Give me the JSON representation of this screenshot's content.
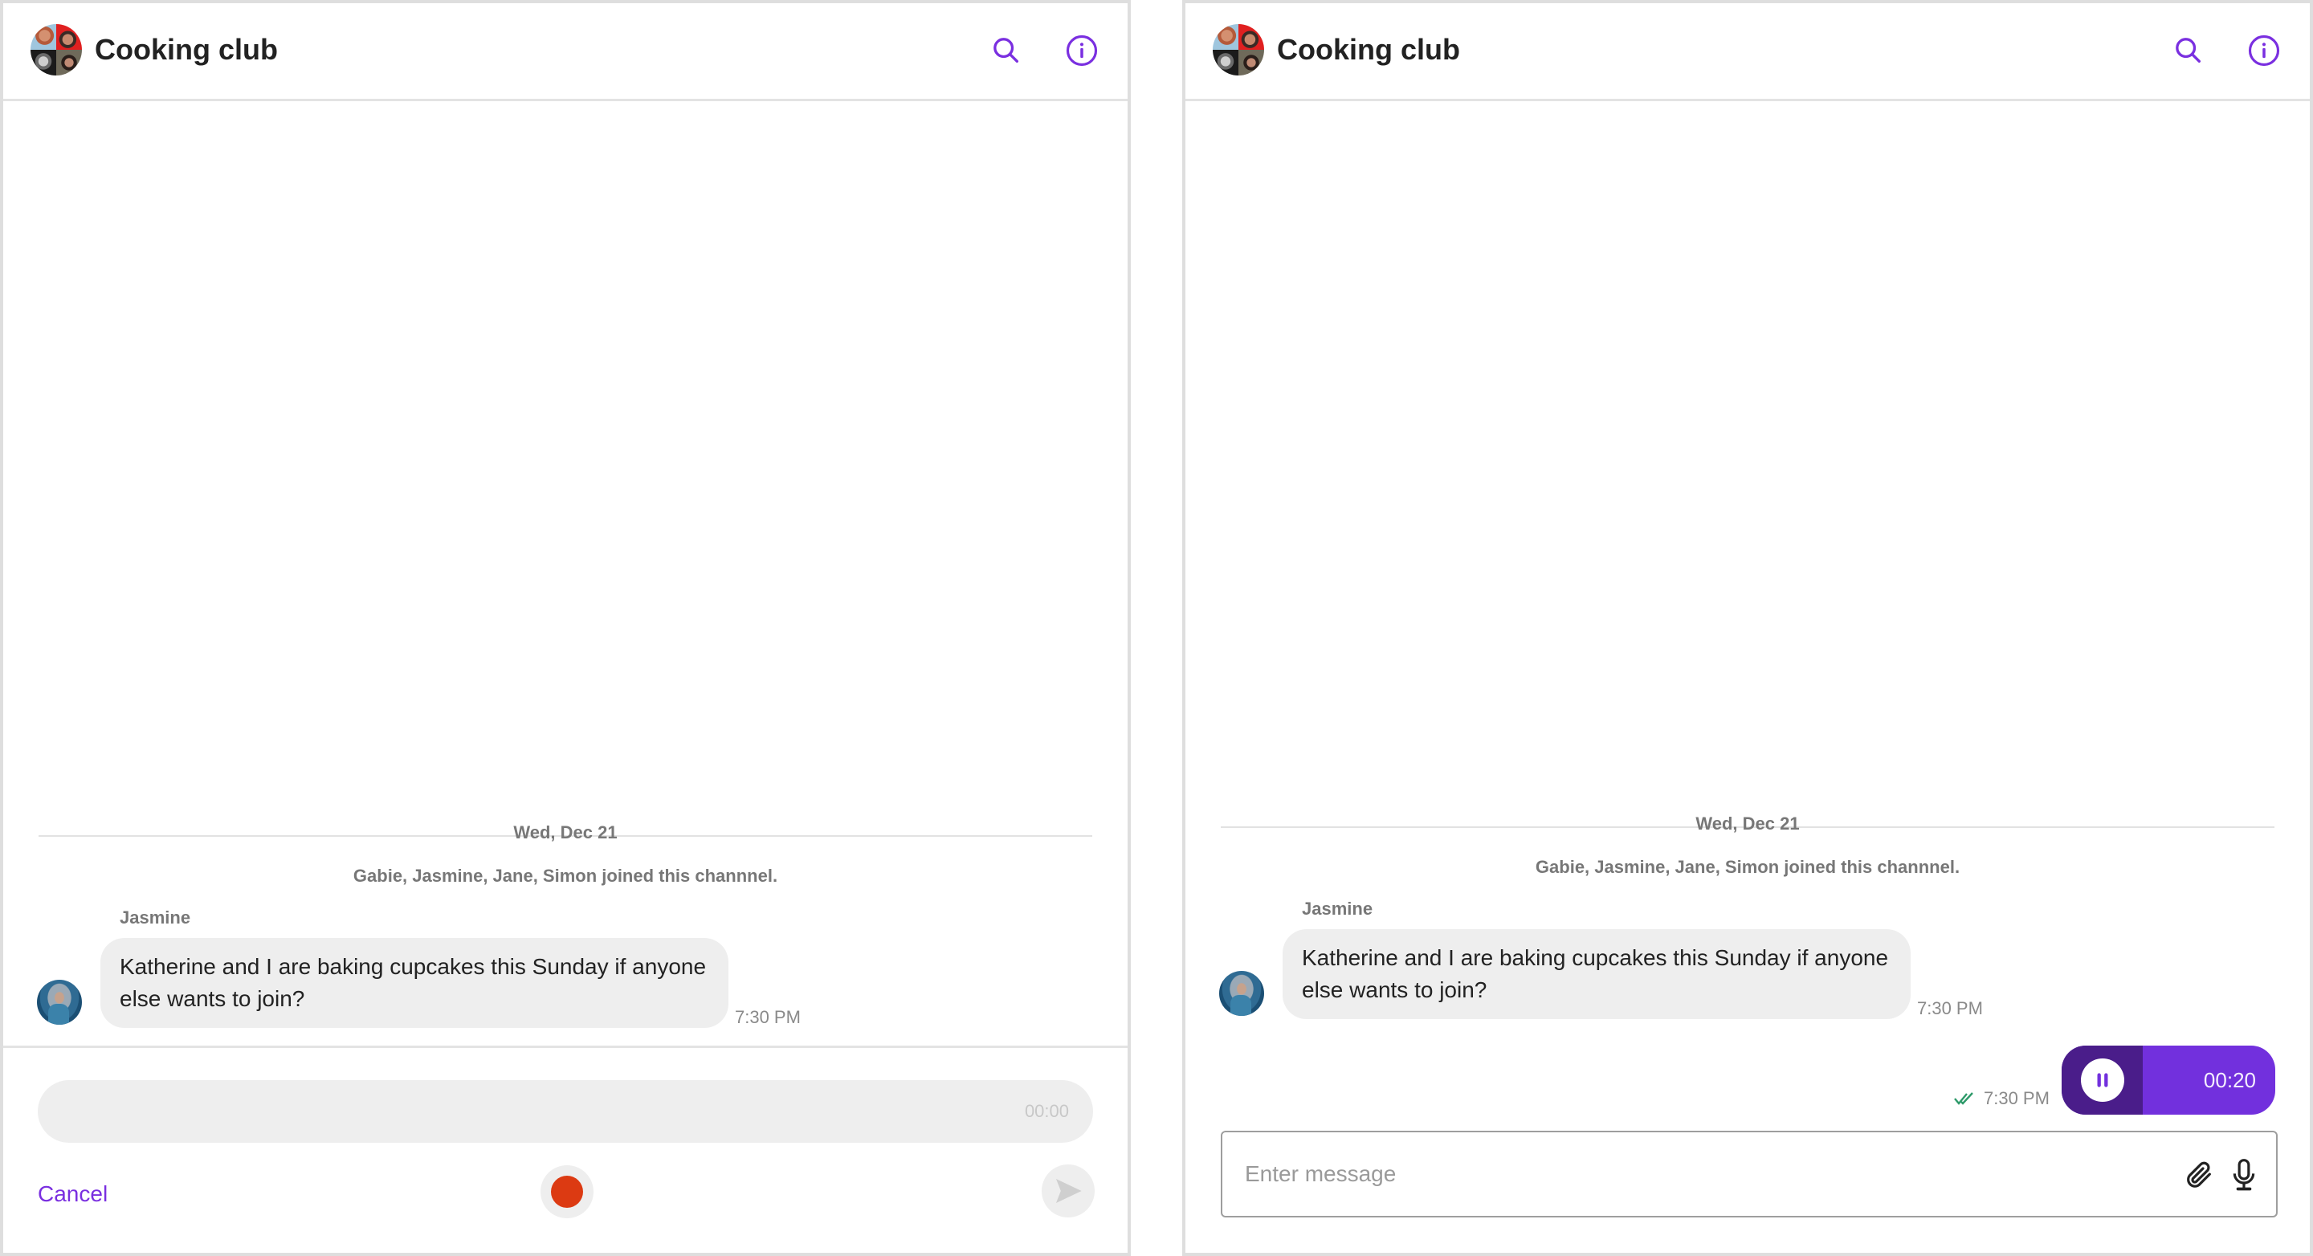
{
  "colors": {
    "accent": "#7a2fe0",
    "record_red": "#dc3a12",
    "voice_bubble": "#7230dd",
    "voice_progress": "#4a1d8a",
    "read_check": "#2e9a6a",
    "bubble_bg": "#eeeeee"
  },
  "panels": [
    {
      "header": {
        "title": "Cooking club",
        "avatar_icon": "group-avatar",
        "search_icon": "search-icon",
        "info_icon": "info-icon"
      },
      "messages": {
        "date_divider": "Wed, Dec 21",
        "system_message": "Gabie, Jasmine, Jane, Simon joined this channnel.",
        "incoming": {
          "sender": "Jasmine",
          "text": "Katherine and I are baking cupcakes this Sunday if anyone else wants to join?",
          "time": "7:30 PM"
        }
      },
      "recorder": {
        "elapsed": "00:00",
        "cancel_label": "Cancel",
        "record_icon": "record-icon",
        "send_icon": "send-icon"
      }
    },
    {
      "header": {
        "title": "Cooking club",
        "avatar_icon": "group-avatar",
        "search_icon": "search-icon",
        "info_icon": "info-icon"
      },
      "messages": {
        "date_divider": "Wed, Dec 21",
        "system_message": "Gabie, Jasmine, Jane, Simon joined this channnel.",
        "incoming": {
          "sender": "Jasmine",
          "text": "Katherine and I are baking cupcakes this Sunday if anyone else wants to join?",
          "time": "7:30 PM"
        },
        "outgoing_voice": {
          "time": "7:30 PM",
          "status": "read",
          "status_icon": "double-check-icon",
          "play_state_icon": "pause-icon",
          "duration": "00:20",
          "progress_fraction": 0.38
        }
      },
      "composer": {
        "placeholder": "Enter message",
        "value": "",
        "attach_icon": "paperclip-icon",
        "mic_icon": "microphone-icon"
      }
    }
  ]
}
